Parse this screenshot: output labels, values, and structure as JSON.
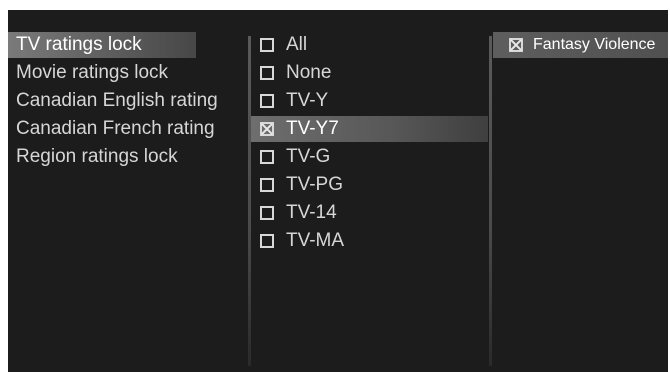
{
  "left_menu": {
    "items": [
      {
        "label": "TV ratings lock",
        "selected": true
      },
      {
        "label": "Movie ratings lock",
        "selected": false
      },
      {
        "label": "Canadian English rating",
        "selected": false
      },
      {
        "label": "Canadian French rating",
        "selected": false
      },
      {
        "label": "Region ratings lock",
        "selected": false
      }
    ]
  },
  "ratings": {
    "items": [
      {
        "label": "All",
        "checked": false,
        "selected": false
      },
      {
        "label": "None",
        "checked": false,
        "selected": false
      },
      {
        "label": "TV-Y",
        "checked": false,
        "selected": false
      },
      {
        "label": "TV-Y7",
        "checked": true,
        "selected": true
      },
      {
        "label": "TV-G",
        "checked": false,
        "selected": false
      },
      {
        "label": "TV-PG",
        "checked": false,
        "selected": false
      },
      {
        "label": "TV-14",
        "checked": false,
        "selected": false
      },
      {
        "label": "TV-MA",
        "checked": false,
        "selected": false
      }
    ]
  },
  "content": {
    "items": [
      {
        "label": "Fantasy Violence",
        "checked": true
      }
    ]
  }
}
